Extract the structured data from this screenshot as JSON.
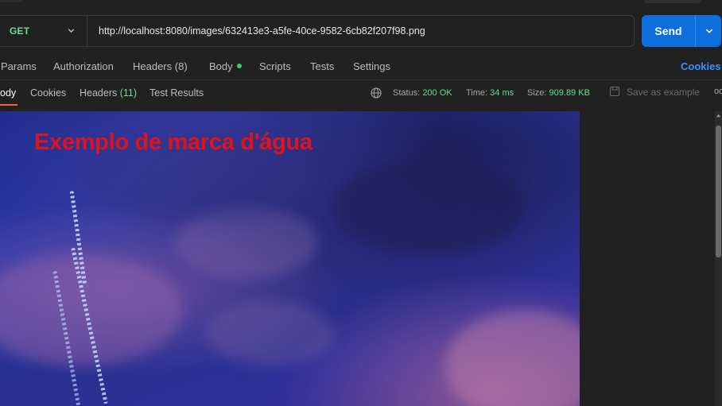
{
  "request": {
    "method": "GET",
    "url": "http://localhost:8080/images/632413e3-a5fe-40ce-9582-6cb82f207f98.png",
    "send_label": "Send"
  },
  "request_tabs": {
    "params": "Params",
    "authorization": "Authorization",
    "headers": "Headers",
    "headers_count": "(8)",
    "body": "Body",
    "scripts": "Scripts",
    "tests": "Tests",
    "settings": "Settings",
    "cookies": "Cookies"
  },
  "response_tabs": {
    "body": "ody",
    "cookies": "Cookies",
    "headers": "Headers",
    "headers_count": "(11)",
    "test_results": "Test Results"
  },
  "response_status": {
    "status_label": "Status:",
    "status_value": "200 OK",
    "time_label": "Time:",
    "time_value": "34 ms",
    "size_label": "Size:",
    "size_value": "909.89 KB",
    "save_example": "Save as example",
    "more": "oo"
  },
  "image": {
    "watermark_text": "Exemplo de marca d'água"
  },
  "colors": {
    "accent": "#0d6fde",
    "success": "#6bdd9a",
    "active_tab": "#ef6b2d",
    "watermark": "#e0131d"
  },
  "icons": [
    "chevron-down-icon",
    "globe-icon",
    "save-icon",
    "more-icon",
    "scroll-up-icon"
  ]
}
